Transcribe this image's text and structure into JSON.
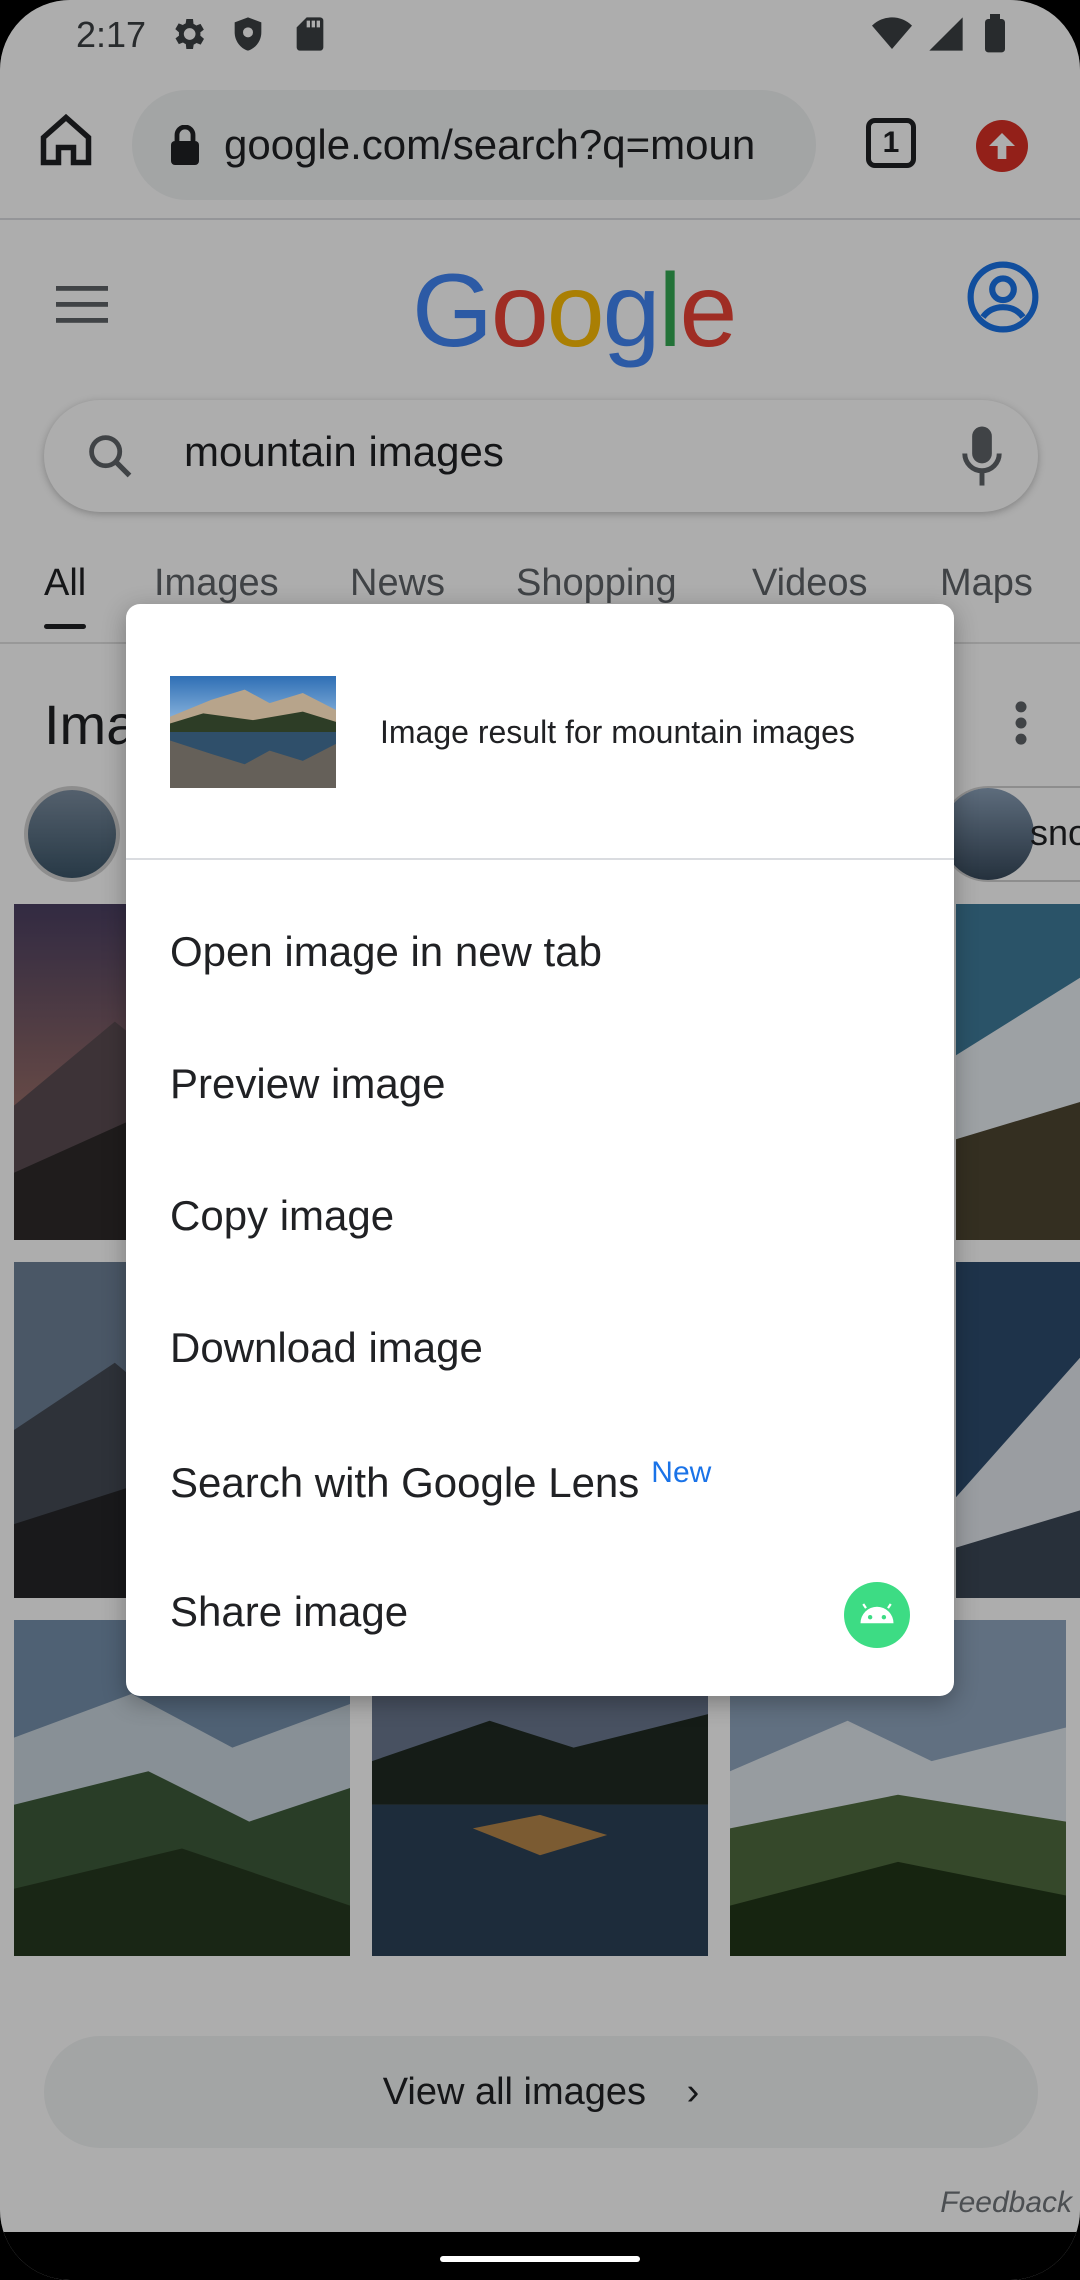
{
  "status_bar": {
    "time": "2:17"
  },
  "toolbar": {
    "url": "google.com/search?q=moun",
    "tab_count": "1"
  },
  "google": {
    "logo_letters": [
      "G",
      "o",
      "o",
      "g",
      "l",
      "e"
    ],
    "logo_colors": [
      "#4285f4",
      "#ea4335",
      "#fbbc05",
      "#4285f4",
      "#34a853",
      "#ea4335"
    ],
    "query": "mountain images",
    "tabs": [
      "All",
      "Images",
      "News",
      "Shopping",
      "Videos",
      "Maps"
    ],
    "section_title": "Ima",
    "chip_right_text": "sno",
    "view_all_label": "View all images",
    "feedback_label": "Feedback"
  },
  "context_menu": {
    "title": "Image result for mountain images",
    "items": [
      {
        "label": "Open image in new tab"
      },
      {
        "label": "Preview image"
      },
      {
        "label": "Copy image"
      },
      {
        "label": "Download image"
      },
      {
        "label": "Search with Google Lens",
        "badge": "New"
      },
      {
        "label": "Share image"
      }
    ]
  },
  "colors": {
    "accent_blue": "#1a73e8",
    "update_red": "#d93025",
    "android_green": "#3ddc84"
  }
}
